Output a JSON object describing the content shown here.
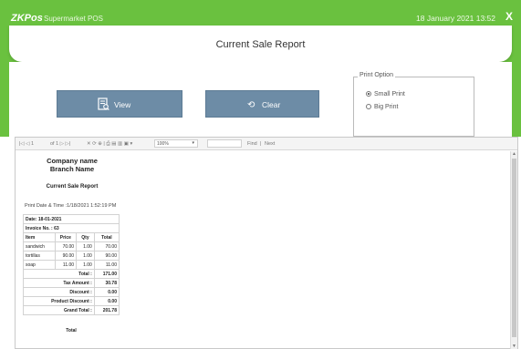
{
  "titlebar": {
    "logo_zk": "ZK",
    "logo_pos": "Pos",
    "app_title": "Supermarket POS",
    "datetime": "18 January 2021 13:52",
    "close": "X"
  },
  "header": {
    "title": "Current Sale Report"
  },
  "actions": {
    "view_label": "View",
    "clear_label": "Clear"
  },
  "print_option": {
    "legend": "Print Option",
    "options": [
      {
        "label": "Small Print",
        "selected": true
      },
      {
        "label": "Big Print",
        "selected": false
      }
    ]
  },
  "toolbar": {
    "nav": "|◁  ◁  1",
    "of": "of 1 ▷  ▷|",
    "icons": "✕  ⟳  ⊕  |  ⎙  ▤  ▥  ▣ ▾",
    "zoom": "100%",
    "find": "Find",
    "next": "Next"
  },
  "report": {
    "company_name": "Company name",
    "branch_name": "Branch Name",
    "title": "Current Sale Report",
    "print_datetime": "Print Date & Time :1/18/2021 1:52:19 PM",
    "date": "Date: 18-01-2021",
    "invoice": "Invoice No. : 63",
    "columns": [
      "Item",
      "Price",
      "Qty",
      "Total"
    ],
    "items": [
      {
        "item": "sandwich",
        "price": "70.00",
        "qty": "1.00",
        "total": "70.00"
      },
      {
        "item": "tortillas",
        "price": "90.00",
        "qty": "1.00",
        "total": "90.00"
      },
      {
        "item": "soap",
        "price": "11.00",
        "qty": "1.00",
        "total": "11.00"
      }
    ],
    "total_label": "Total :",
    "total_value": "171.00",
    "tax_label": "Tax Amount :",
    "tax_value": "30.78",
    "discount_label": "Discount :",
    "discount_value": "0.00",
    "product_discount_label": "Product Discount :",
    "product_discount_value": "0.00",
    "grand_total_label": "Grand Total :",
    "grand_total_value": "201.78",
    "footer_total_label": "Total"
  },
  "colors": {
    "accent_green": "#6ac13f",
    "button_blue": "#6d8ca6"
  }
}
